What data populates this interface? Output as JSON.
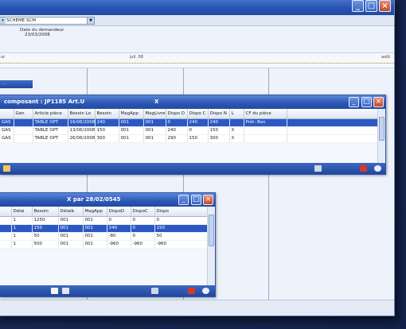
{
  "toolbar": {
    "combo_value": "SCHEME SCM",
    "combo_arrow": "▼"
  },
  "header": {
    "date_label": "Date du demandeur",
    "date_value": "23/03/2008"
  },
  "timeline": {
    "labels": [
      "ur",
      "juil. 08",
      "août"
    ]
  },
  "top_window": {
    "title": "composant : JP1185 Art.U",
    "title_mark": "X",
    "columns": [
      "Gen",
      "Article pièce",
      "Besoin Lo",
      "Besoin",
      "MagApp",
      "MagLivre",
      "Dispo D",
      "Dispo C",
      "Dispo N",
      "L",
      "CF du pièce"
    ],
    "rows": [
      {
        "left": "GAS",
        "cells": [
          "",
          "TABLE OPT",
          "16/06/2008",
          "240",
          "001",
          "001",
          "0",
          "240",
          "240",
          "",
          "Prêt: Bon"
        ],
        "selected": true
      },
      {
        "left": "GAS",
        "cells": [
          "",
          "TABLE OPT",
          "13/06/2008",
          "150",
          "001",
          "001",
          "240",
          "0",
          "150",
          "X",
          ""
        ],
        "selected": false
      },
      {
        "left": "GAS",
        "cells": [
          "",
          "TABLE OPT",
          "26/06/2008",
          "300",
          "001",
          "001",
          "290",
          "150",
          "300",
          "X",
          ""
        ],
        "selected": false
      }
    ]
  },
  "bottom_window": {
    "title": "X par 28/02/0545",
    "columns": [
      "Délai",
      "Besoin",
      "Délaib",
      "MagApp",
      "DispoD",
      "DispoC",
      "Dispo"
    ],
    "rows": [
      {
        "left": "",
        "cells": [
          "1",
          "1250",
          "001",
          "001",
          "0",
          "0",
          "0"
        ],
        "selected": false
      },
      {
        "left": "",
        "cells": [
          "1",
          "150",
          "001",
          "001",
          "240",
          "0",
          "150"
        ],
        "selected": true
      },
      {
        "left": "",
        "cells": [
          "1",
          "50",
          "001",
          "001",
          "-80",
          "0",
          "50"
        ],
        "selected": false
      },
      {
        "left": "",
        "cells": [
          "1",
          "500",
          "001",
          "001",
          "-960",
          "-960",
          "-960"
        ],
        "selected": false
      }
    ]
  },
  "colors": {
    "accent": "#2b59c3",
    "titlebar": "#2a55b3",
    "close": "#c74a2a"
  }
}
